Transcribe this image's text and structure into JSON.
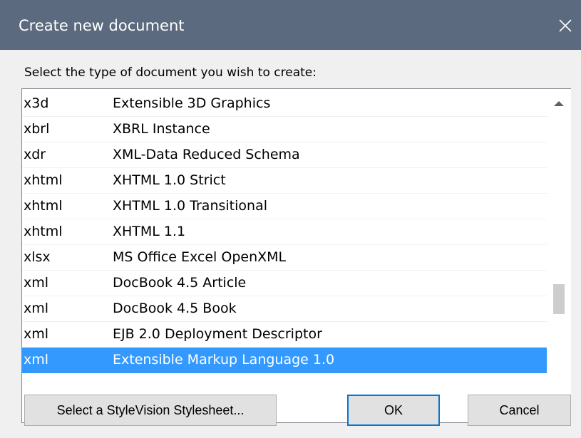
{
  "window": {
    "title": "Create new document"
  },
  "prompt": "Select the type of document you wish to create:",
  "document_types": [
    {
      "ext": "x3d",
      "description": "Extensible 3D Graphics",
      "selected": false
    },
    {
      "ext": "xbrl",
      "description": "XBRL Instance",
      "selected": false
    },
    {
      "ext": "xdr",
      "description": "XML-Data Reduced Schema",
      "selected": false
    },
    {
      "ext": "xhtml",
      "description": "XHTML 1.0 Strict",
      "selected": false
    },
    {
      "ext": "xhtml",
      "description": "XHTML 1.0 Transitional",
      "selected": false
    },
    {
      "ext": "xhtml",
      "description": "XHTML 1.1",
      "selected": false
    },
    {
      "ext": "xlsx",
      "description": "MS Office Excel OpenXML",
      "selected": false
    },
    {
      "ext": "xml",
      "description": "DocBook 4.5 Article",
      "selected": false
    },
    {
      "ext": "xml",
      "description": "DocBook 4.5 Book",
      "selected": false
    },
    {
      "ext": "xml",
      "description": "EJB 2.0 Deployment Descriptor",
      "selected": false
    },
    {
      "ext": "xml",
      "description": "Extensible Markup Language 1.0",
      "selected": true
    }
  ],
  "buttons": {
    "stylevision": "Select a StyleVision Stylesheet...",
    "ok": "OK",
    "cancel": "Cancel"
  },
  "icons": {
    "close": "close-icon",
    "scroll_up": "scroll-up-arrow-icon",
    "scroll_down": "scroll-down-arrow-icon"
  },
  "colors": {
    "titlebar": "#5b6a7e",
    "selection": "#3399ff",
    "default_button_border": "#0078d7"
  }
}
